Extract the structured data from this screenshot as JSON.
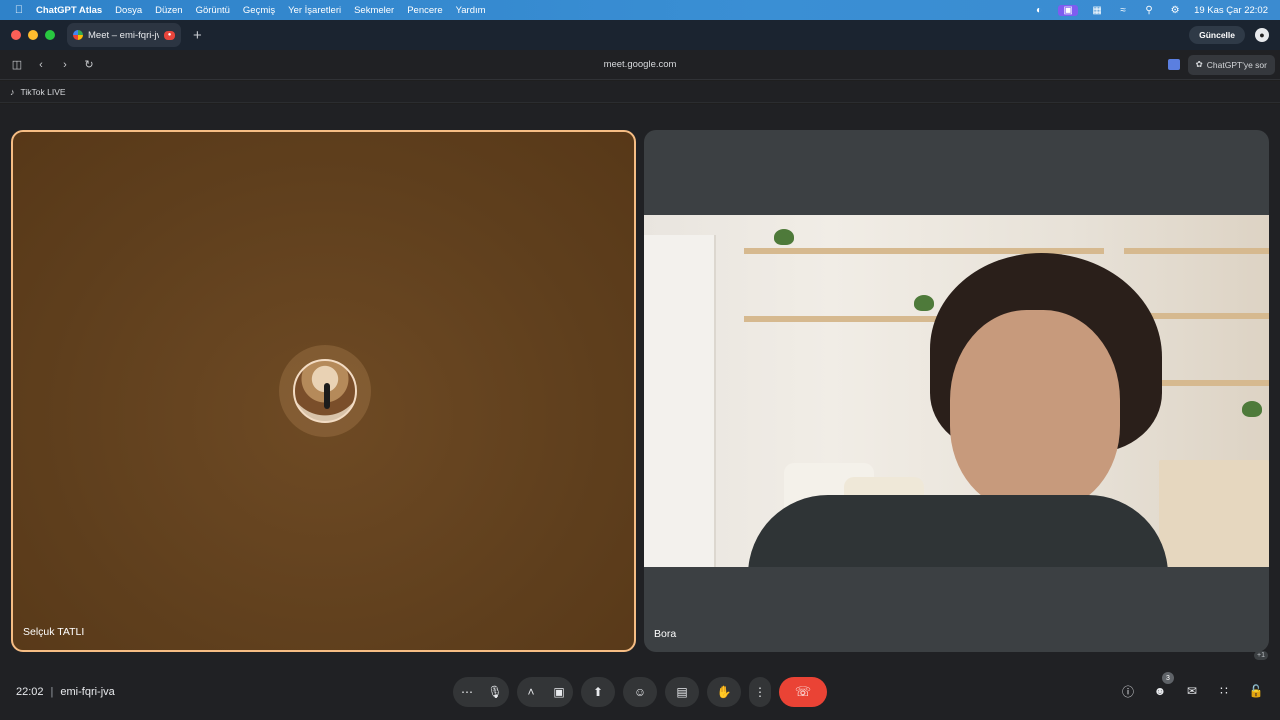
{
  "menubar": {
    "app_name": "ChatGPT Atlas",
    "items": [
      "Dosya",
      "Düzen",
      "Görüntü",
      "Geçmiş",
      "Yer İşaretleri",
      "Sekmeler",
      "Pencere",
      "Yardım"
    ],
    "datetime": "19 Kas Çar  22:02"
  },
  "tabs": {
    "active_title": "Meet – emi-fqri-jva",
    "new_tab_glyph": "+"
  },
  "toolbar": {
    "url": "meet.google.com",
    "update_label": "Güncelle",
    "ask_label": "ChatGPT'ye sor"
  },
  "bookmarks": {
    "items": [
      {
        "label": "TikTok LIVE",
        "icon": "tiktok-icon"
      }
    ]
  },
  "participants": [
    {
      "name": "Selçuk TATLI",
      "video": false,
      "active_speaker": true
    },
    {
      "name": "Bora",
      "video": true,
      "active_speaker": false
    }
  ],
  "overflow_label": "+1",
  "meeting": {
    "time": "22:02",
    "separator": "|",
    "code": "emi-fqri-jva"
  },
  "controls": {
    "center_icons": [
      "more-options-icon",
      "microphone-icon",
      "chevron-up-icon",
      "camera-icon",
      "present-screen-icon",
      "emoji-icon",
      "captions-icon",
      "raise-hand-icon",
      "more-vert-icon",
      "end-call-icon"
    ],
    "right_icons": [
      "info-icon",
      "people-icon",
      "chat-icon",
      "activities-icon",
      "host-controls-icon"
    ],
    "people_count": "3"
  },
  "colors": {
    "active_border": "#f6bd84",
    "end_call": "#ea4335",
    "menubar": "#3a8fd4"
  }
}
